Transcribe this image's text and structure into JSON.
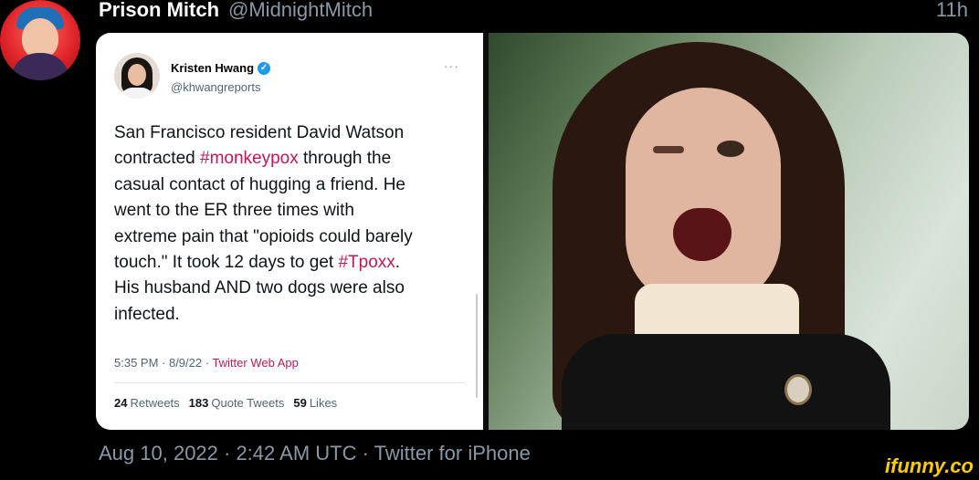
{
  "header": {
    "display_name": "Prison Mitch",
    "handle": "@MidnightMitch",
    "timestamp": "11h"
  },
  "quoted_tweet": {
    "name": "Kristen Hwang",
    "handle": "@khwangreports",
    "more": "···",
    "body_lines": [
      [
        "San Francisco resident David Watson"
      ],
      [
        "contracted ",
        "#monkeypox",
        " through the"
      ],
      [
        "casual contact of hugging a friend. He"
      ],
      [
        "went to the ER three times with"
      ],
      [
        "extreme pain that \"opioids could barely"
      ],
      [
        "touch.\" It took 12 days to get ",
        "#Tpoxx",
        "."
      ],
      [
        "His husband AND two dogs were also"
      ],
      [
        "infected."
      ]
    ],
    "meta_time": "5:35 PM · 8/9/22 · ",
    "meta_app": "Twitter Web App",
    "stats": [
      {
        "count": "24",
        "label": "Retweets"
      },
      {
        "count": "183",
        "label": "Quote Tweets"
      },
      {
        "count": "59",
        "label": "Likes"
      }
    ]
  },
  "footer": {
    "text": "Aug 10, 2022 · 2:42 AM UTC · Twitter for iPhone"
  },
  "watermark": "ifunny.co",
  "colors": {
    "hashtag": "#c2185b",
    "verified": "#1d9bf0",
    "watermark": "#ffcc00"
  },
  "icons": {
    "verified": "verified-badge-icon"
  }
}
